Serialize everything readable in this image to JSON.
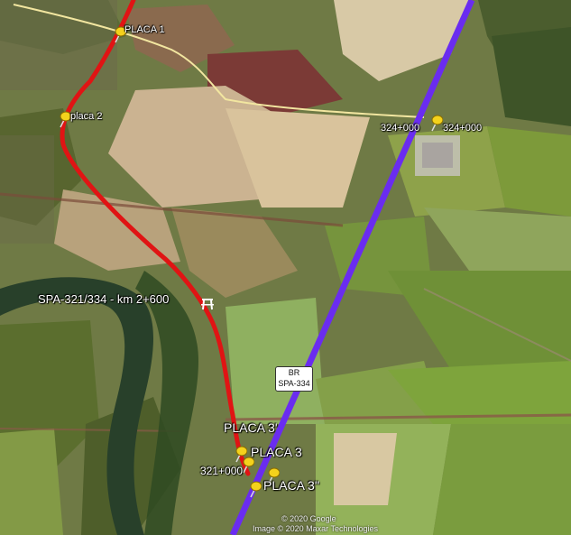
{
  "map": {
    "labels": {
      "placa1": "PLACA 1",
      "placa2": "placa 2",
      "km324_left": "324+000",
      "km324_right": "324+000",
      "spa_label": "SPA-321/334 - km 2+600",
      "placa3_prime": "PLACA 3'",
      "placa3": "PLACA 3",
      "km321": "321+000",
      "placa3_double": "PLACA 3''"
    },
    "shield": {
      "line1": "BR",
      "line2": "SPA-334"
    },
    "copyright": {
      "line1": "© 2020 Google",
      "line2": "Image © 2020 Maxar Technologies"
    },
    "colors": {
      "route_red": "#e01414",
      "route_purple": "#6a2cf0",
      "local_road": "#f2e6a0",
      "pin": "#f4d21c"
    },
    "icons": [
      "pushpin-icon",
      "bridge-icon",
      "highway-shield-icon"
    ]
  }
}
